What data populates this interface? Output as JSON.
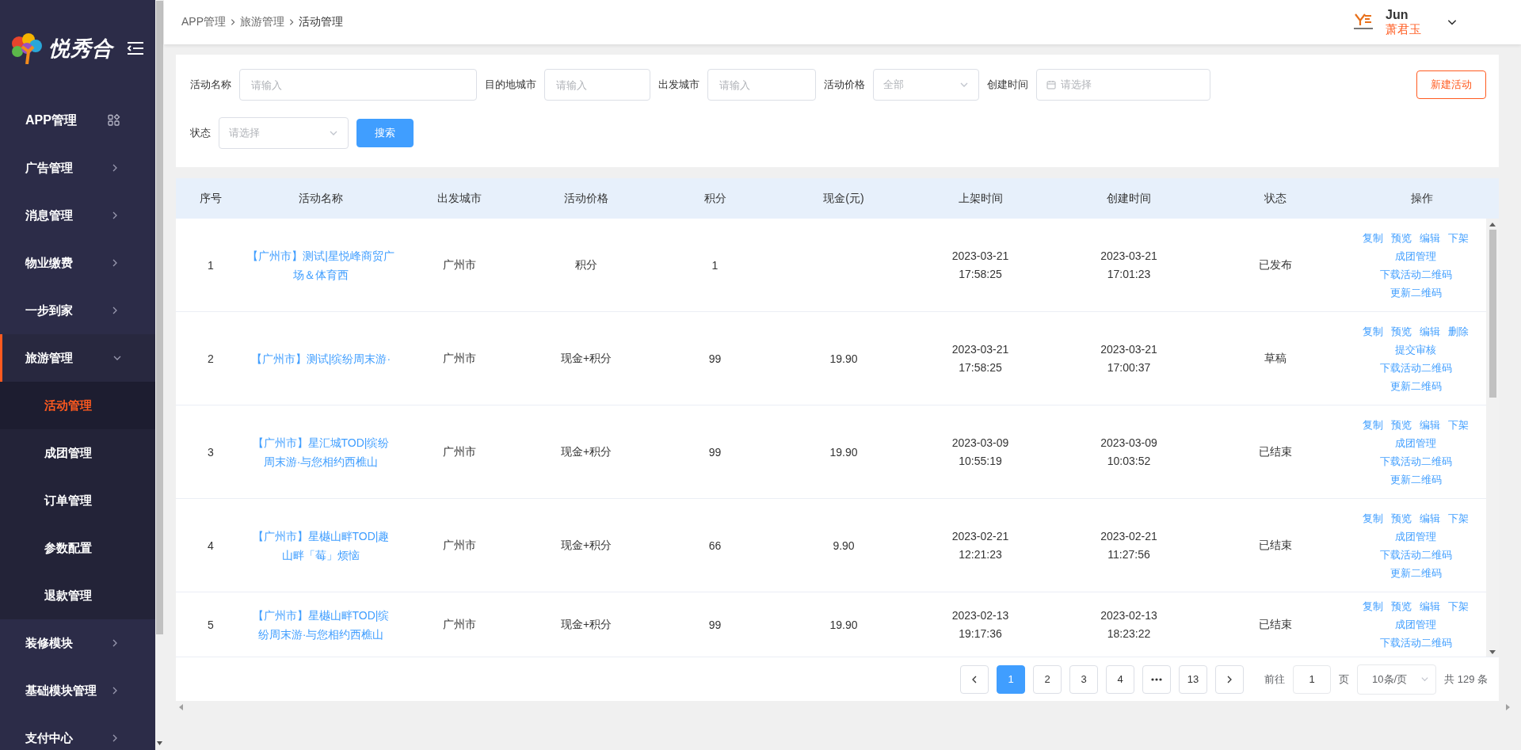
{
  "sidebar": {
    "logo_text": "悦秀合",
    "items": [
      {
        "label": "APP管理",
        "kind": "home"
      },
      {
        "label": "广告管理",
        "kind": "menu",
        "expanded": false
      },
      {
        "label": "消息管理",
        "kind": "menu",
        "expanded": false
      },
      {
        "label": "物业缴费",
        "kind": "menu",
        "expanded": false
      },
      {
        "label": "一步到家",
        "kind": "menu",
        "expanded": false
      },
      {
        "label": "旅游管理",
        "kind": "menu",
        "expanded": true,
        "children": [
          {
            "label": "活动管理",
            "selected": true
          },
          {
            "label": "成团管理",
            "selected": false
          },
          {
            "label": "订单管理",
            "selected": false
          },
          {
            "label": "参数配置",
            "selected": false
          },
          {
            "label": "退款管理",
            "selected": false
          }
        ]
      },
      {
        "label": "装修模块",
        "kind": "menu",
        "expanded": false
      },
      {
        "label": "基础模块管理",
        "kind": "menu",
        "expanded": false
      },
      {
        "label": "支付中心",
        "kind": "menu",
        "expanded": false
      }
    ]
  },
  "header": {
    "breadcrumb": [
      "APP管理",
      "旅游管理",
      "活动管理"
    ],
    "user": {
      "name": "Jun",
      "display_name": "萧君玉"
    }
  },
  "filters": {
    "fields": [
      {
        "label": "活动名称",
        "kind": "input",
        "placeholder": "请输入"
      },
      {
        "label": "目的地城市",
        "kind": "input",
        "placeholder": "请输入"
      },
      {
        "label": "出发城市",
        "kind": "input",
        "placeholder": "请输入"
      },
      {
        "label": "活动价格",
        "kind": "select",
        "value": "全部"
      },
      {
        "label": "创建时间",
        "kind": "date",
        "placeholder": "请选择"
      },
      {
        "label": "状态",
        "kind": "select",
        "placeholder": "请选择"
      }
    ],
    "search_button": "搜索",
    "new_button": "新建活动"
  },
  "table": {
    "columns": [
      "序号",
      "活动名称",
      "出发城市",
      "活动价格",
      "积分",
      "现金(元)",
      "上架时间",
      "创建时间",
      "状态",
      "操作"
    ],
    "rows": [
      {
        "index": "1",
        "name": "【广州市】测试|星悦峰商贸广场＆体育西",
        "city": "广州市",
        "price_type": "积分",
        "points": "1",
        "listed_date": "2023-03-21",
        "listed_time": "17:58:25",
        "created_date": "2023-03-21",
        "created_time": "17:01:23",
        "status": "已发布",
        "actions": [
          [
            "复制",
            "预览",
            "编辑",
            "下架"
          ],
          [
            "成团管理"
          ],
          [
            "下载活动二维码"
          ],
          [
            "更新二维码"
          ]
        ]
      },
      {
        "index": "2",
        "name": "【广州市】测试|缤纷周末游·",
        "city": "广州市",
        "price_type": "现金+积分",
        "points": "99",
        "cash": "19.90",
        "listed_date": "2023-03-21",
        "listed_time": "17:58:25",
        "created_date": "2023-03-21",
        "created_time": "17:00:37",
        "status": "草稿",
        "actions": [
          [
            "复制",
            "预览",
            "编辑",
            "删除"
          ],
          [
            "提交审核"
          ],
          [
            "下载活动二维码"
          ],
          [
            "更新二维码"
          ]
        ]
      },
      {
        "index": "3",
        "name": "【广州市】星汇城TOD|缤纷周末游·与您相约西樵山",
        "city": "广州市",
        "price_type": "现金+积分",
        "points": "99",
        "cash": "19.90",
        "listed_date": "2023-03-09",
        "listed_time": "10:55:19",
        "created_date": "2023-03-09",
        "created_time": "10:03:52",
        "status": "已结束",
        "actions": [
          [
            "复制",
            "预览",
            "编辑",
            "下架"
          ],
          [
            "成团管理"
          ],
          [
            "下载活动二维码"
          ],
          [
            "更新二维码"
          ]
        ]
      },
      {
        "index": "4",
        "name": "【广州市】星樾山畔TOD|趣山畔「莓」烦恼",
        "city": "广州市",
        "price_type": "现金+积分",
        "points": "66",
        "cash": "9.90",
        "listed_date": "2023-02-21",
        "listed_time": "12:21:23",
        "created_date": "2023-02-21",
        "created_time": "11:27:56",
        "status": "已结束",
        "actions": [
          [
            "复制",
            "预览",
            "编辑",
            "下架"
          ],
          [
            "成团管理"
          ],
          [
            "下载活动二维码"
          ],
          [
            "更新二维码"
          ]
        ]
      },
      {
        "index": "5",
        "name": "【广州市】星樾山畔TOD|缤纷周末游·与您相约西樵山",
        "city": "广州市",
        "price_type": "现金+积分",
        "points": "99",
        "cash": "19.90",
        "listed_date": "2023-02-13",
        "listed_time": "19:17:36",
        "created_date": "2023-02-13",
        "created_time": "18:23:22",
        "status": "已结束",
        "actions": [
          [
            "复制",
            "预览",
            "编辑",
            "下架"
          ],
          [
            "成团管理"
          ],
          [
            "下载活动二维码"
          ]
        ]
      }
    ]
  },
  "pagination": {
    "pages": [
      {
        "kind": "page",
        "label": "1",
        "selected": true
      },
      {
        "kind": "page",
        "label": "2",
        "selected": false
      },
      {
        "kind": "page",
        "label": "3",
        "selected": false
      },
      {
        "kind": "page",
        "label": "4",
        "selected": false
      },
      {
        "kind": "more",
        "selected": false
      },
      {
        "kind": "page",
        "label": "13",
        "selected": false
      }
    ],
    "goto_label": "前往",
    "goto_value": "1",
    "goto_suffix": "页",
    "page_size": "10条/页",
    "total": "共 129 条"
  }
}
